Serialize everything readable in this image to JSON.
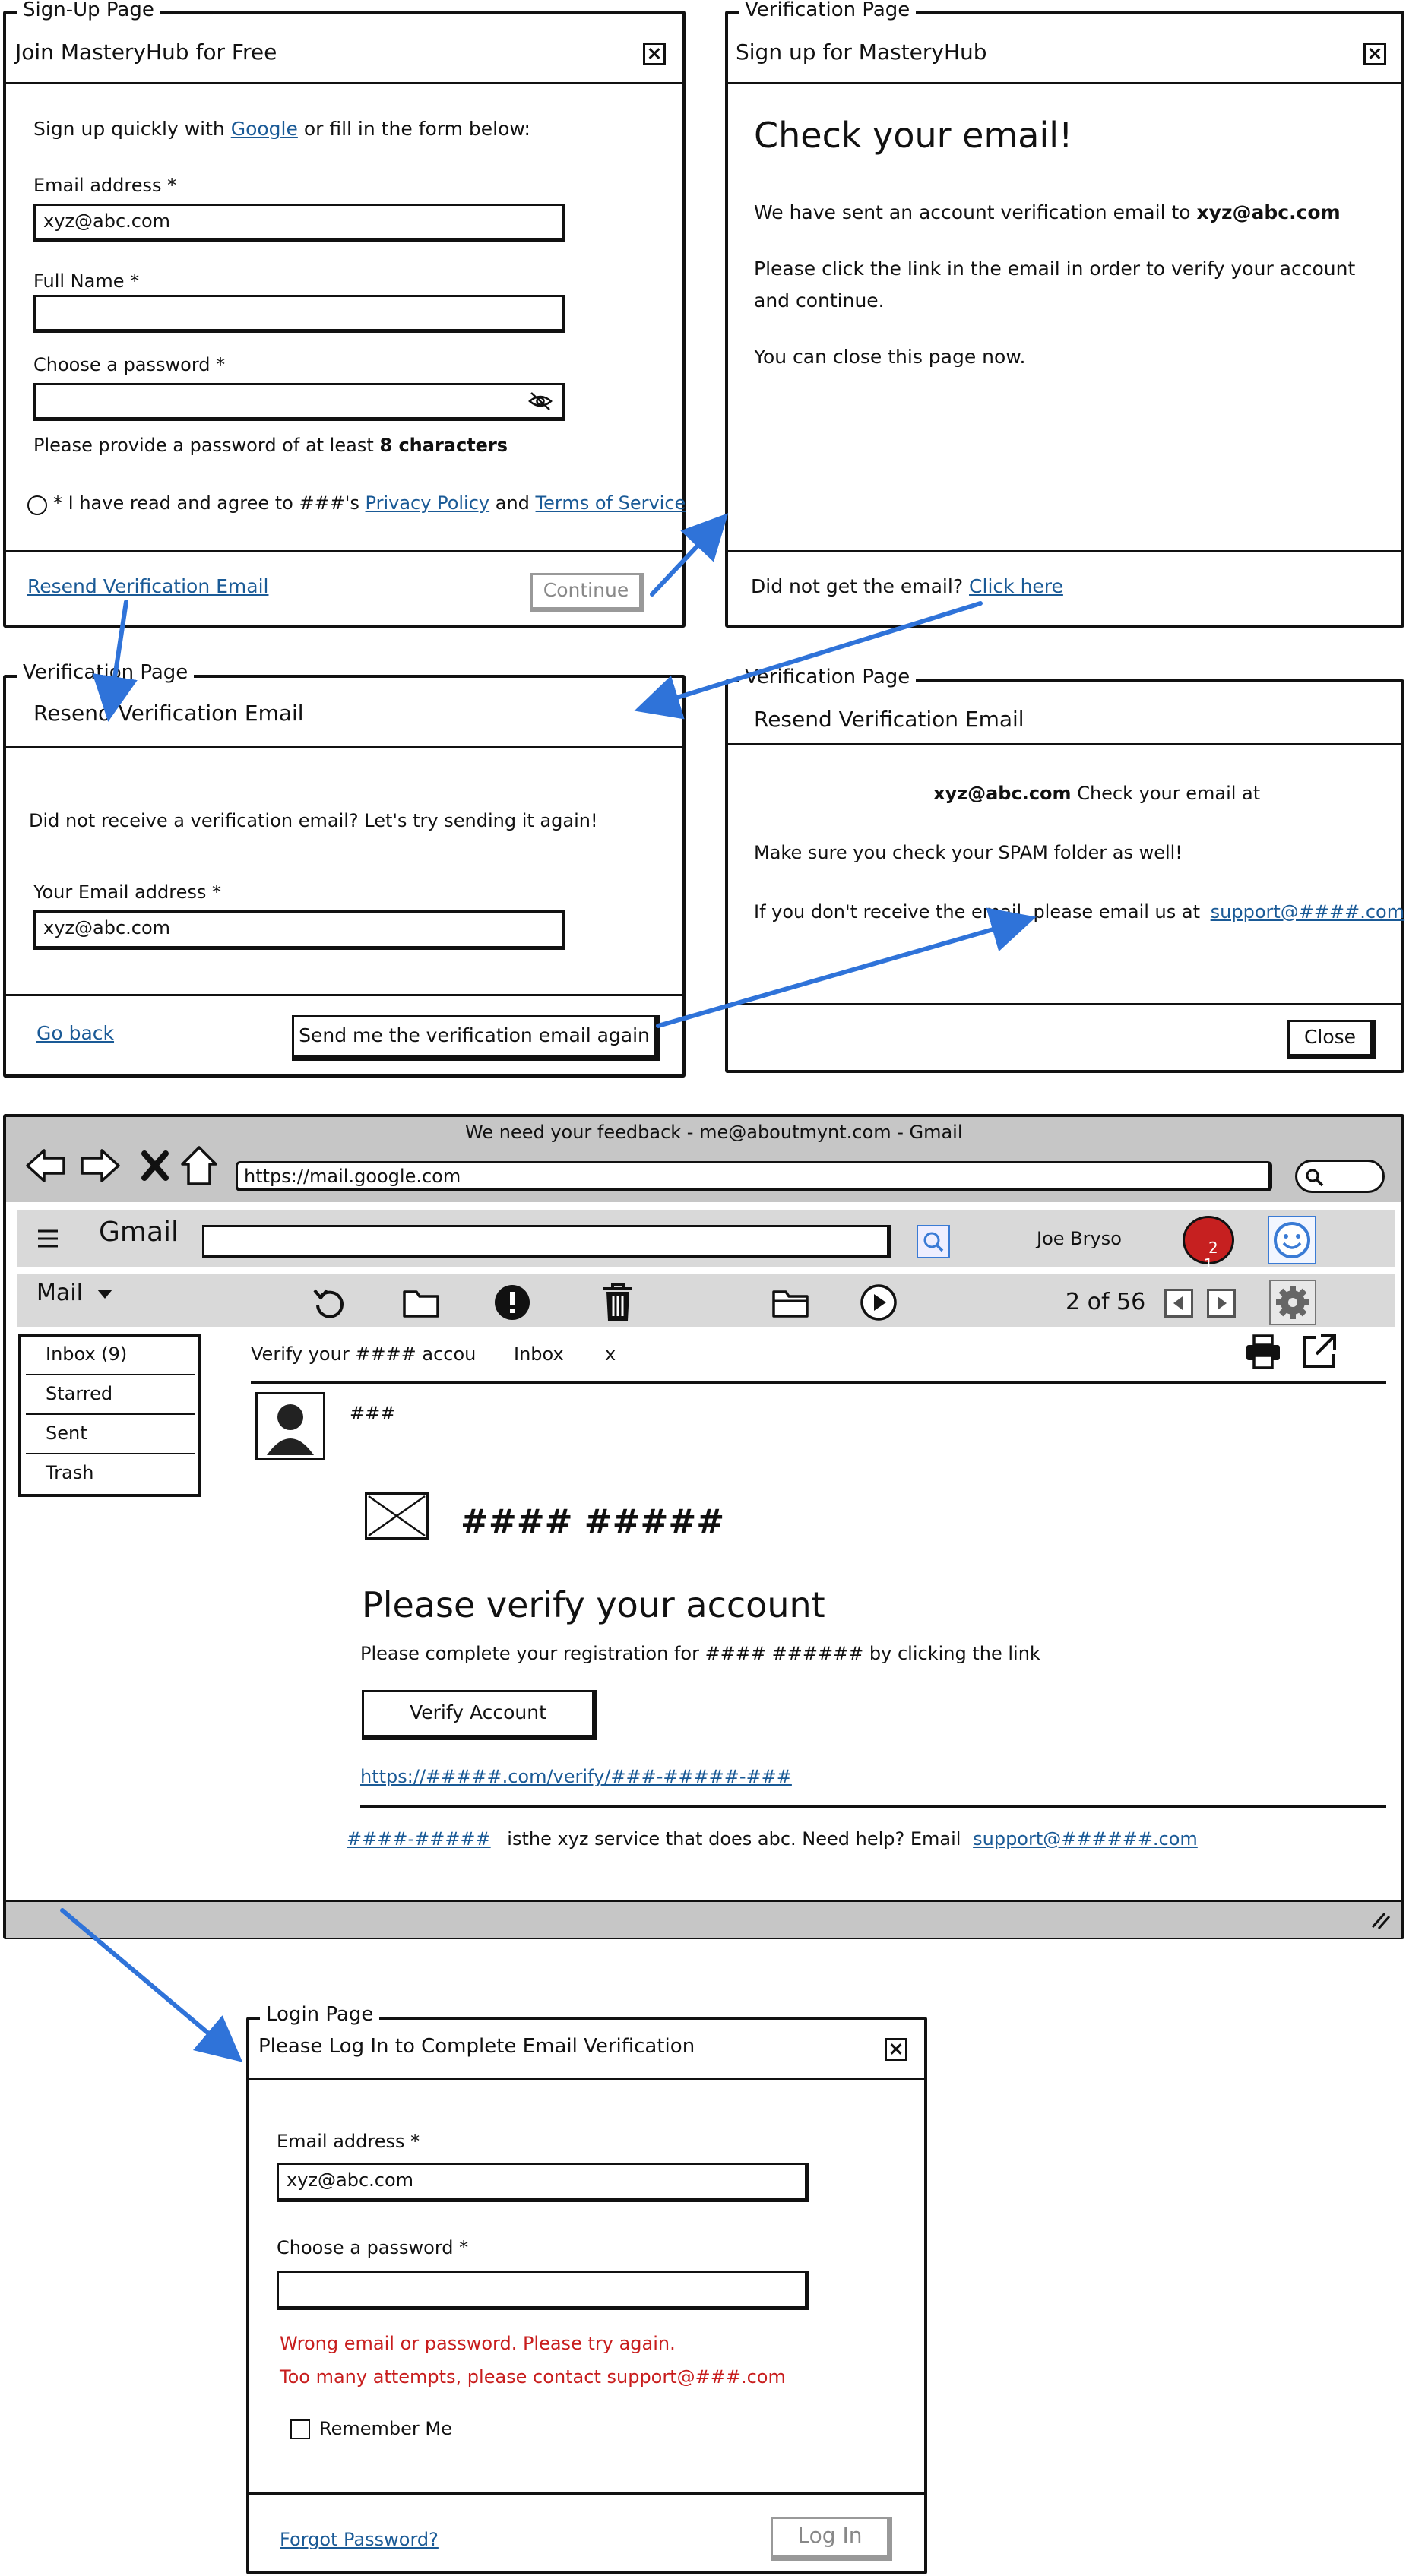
{
  "signup": {
    "frame_label": "Sign-Up Page",
    "title": "Join MasteryHub for Free",
    "intro_prefix": "Sign up quickly with",
    "intro_link": "Google",
    "intro_suffix": "or fill in the form below:",
    "email_label": "Email address *",
    "email_value": "xyz@abc.com",
    "name_label": "Full Name *",
    "password_label": "Choose a password *",
    "password_hint_prefix": "Please provide a password of at least",
    "password_hint_bold": "8 characters",
    "agree_prefix": "* I have read and agree to ###'s",
    "privacy_link": "Privacy Policy",
    "agree_and": "and",
    "terms_link": "Terms of Service",
    "resend_link": "Resend Verification Email",
    "continue_button": "Continue"
  },
  "verify_check": {
    "frame_label": "Verification Page",
    "title": "Sign up for MasteryHub",
    "heading": "Check your email!",
    "line1_prefix": "We have sent an account verification email to",
    "line1_email": "xyz@abc.com",
    "line2": "Please click the link in the email in order to verify your account",
    "line3": "and continue.",
    "line4": "You can close this page now.",
    "footer_prefix": "Did not get the email?",
    "footer_link": "Click here"
  },
  "resend_form": {
    "frame_label": "Verification Page",
    "title": "Resend Verification Email",
    "intro": "Did not receive a verification email? Let's try sending it again!",
    "email_label": "Your Email address *",
    "email_value": "xyz@abc.com",
    "back_link": "Go back",
    "send_button": "Send me the verification email again"
  },
  "resend_done": {
    "frame_label": "Verification Page",
    "title": "Resend Verification Email",
    "line1_email": "xyz@abc.com",
    "line1_suffix": "Check your email at",
    "line2": "Make sure you check your SPAM folder as well!",
    "line3_prefix": "If you don't receive the email, please email us at",
    "line3_link": "support@####.com",
    "close_button": "Close"
  },
  "gmail": {
    "window_title": "We need your feedback - me@aboutmynt.com - Gmail",
    "url": "https://mail.google.com",
    "brand": "Gmail",
    "user_name": "Joe Bryso",
    "notif_count": "2\n1",
    "mail_menu": "Mail",
    "pagination": "2 of 56",
    "folders": [
      "Inbox (9)",
      "Starred",
      "Sent",
      "Trash"
    ],
    "subject": "Verify your #### accou",
    "subject_tag": "Inbox",
    "subject_close": "x",
    "sender": "###",
    "logo_text": "#### #####",
    "email_heading": "Please verify your account",
    "email_body": "Please complete your registration for #### ###### by clicking the link",
    "verify_button": "Verify Account",
    "verify_link": "https://#####.com/verify/###-#####-###",
    "footer_link": "####-#####",
    "footer_text": "isthe xyz service that does abc. Need help? Email",
    "footer_email": "support@######.com"
  },
  "login": {
    "frame_label": "Login Page",
    "title": "Please Log In to Complete Email Verification",
    "email_label": "Email address *",
    "email_value": "xyz@abc.com",
    "password_label": "Choose a password *",
    "error1": "Wrong email or password. Please try again.",
    "error2": "Too many attempts, please contact support@###.com",
    "remember": "Remember Me",
    "forgot_link": "Forgot Password?",
    "login_button": "Log In"
  },
  "colors": {
    "arrow": "#2f73d9",
    "link": "#1a5a96",
    "error": "#c81d1d",
    "chrome_gray": "#c6c6c6",
    "search_blue": "#3a7bd5"
  }
}
